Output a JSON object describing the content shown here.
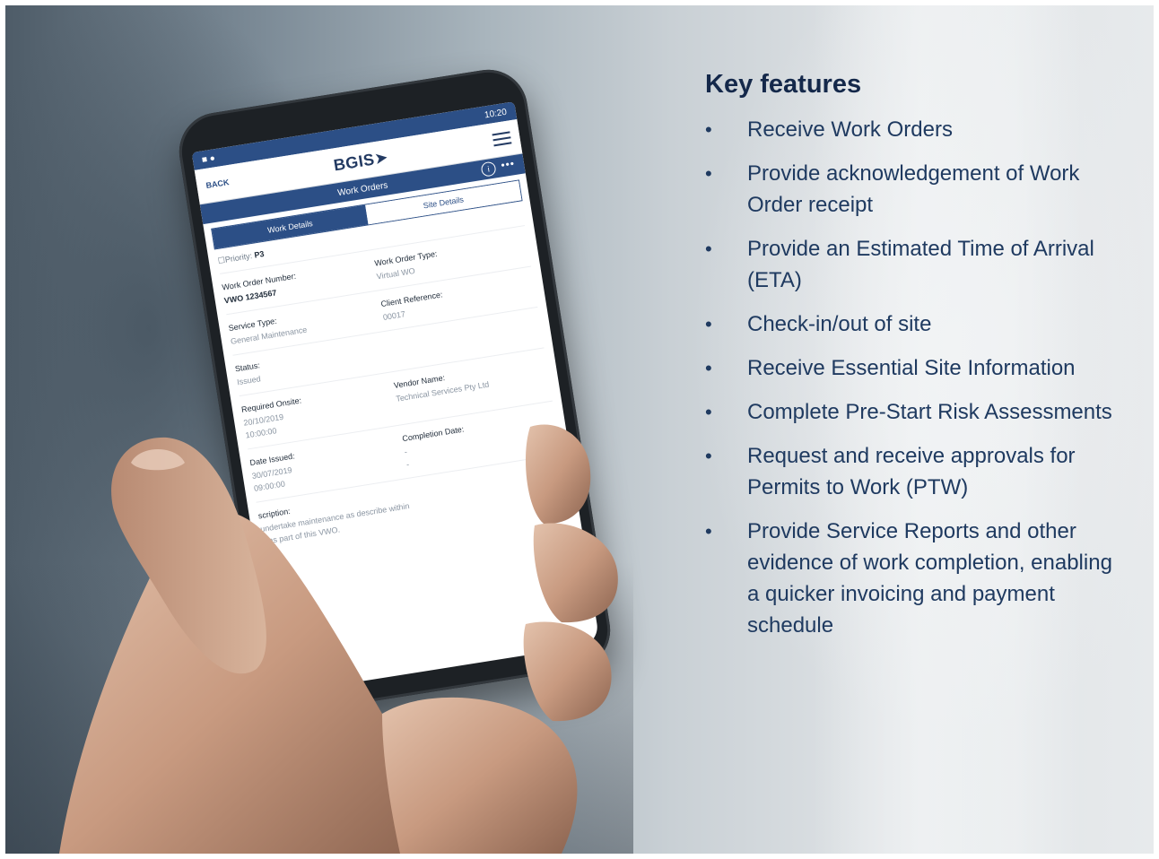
{
  "features": {
    "heading": "Key features",
    "items": [
      "Receive Work Orders",
      "Provide acknowledgement of Work Order receipt",
      "Provide an Estimated Time of Arrival (ETA)",
      "Check-in/out of site",
      "Receive Essential Site Information",
      "Complete Pre-Start Risk Assessments",
      "Request and receive approvals for Permits to Work (PTW)",
      "Provide Service Reports and other evidence of work completion, enabling a quicker invoicing and payment schedule"
    ]
  },
  "phone": {
    "status_time": "10:20",
    "back_label": "BACK",
    "logo": "BGIS",
    "section_title": "Work Orders",
    "tab_work_details": "Work Details",
    "tab_site_details": "Site Details",
    "priority_label": "Priority:",
    "priority_value": "P3",
    "work_order_number_label": "Work Order Number:",
    "work_order_number_value": "VWO 1234567",
    "work_order_type_label": "Work Order Type:",
    "work_order_type_value": "Virtual WO",
    "service_type_label": "Service Type:",
    "service_type_value": "General Maintenance",
    "client_reference_label": "Client Reference:",
    "client_reference_value": "00017",
    "status_label": "Status:",
    "status_value": "Issued",
    "required_onsite_label": "Required Onsite:",
    "required_onsite_date": "20/10/2019",
    "required_onsite_time": "10:00:00",
    "vendor_name_label": "Vendor Name:",
    "vendor_name_value": "Technical Services Pty Ltd",
    "date_issued_label": "Date Issued:",
    "date_issued_date": "30/07/2019",
    "date_issued_time": "09:00:00",
    "completion_date_label": "Completion Date:",
    "completion_date_value1": "-",
    "completion_date_value2": "-",
    "description_label": "scription:",
    "description_line1": "undertake maintenance as describe within",
    "description_line2": "s as part of this VWO."
  }
}
